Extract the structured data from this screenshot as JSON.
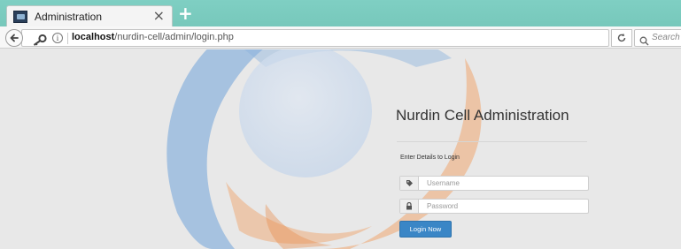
{
  "browser": {
    "tab_title": "Administration",
    "close_glyph": "×",
    "new_tab_glyph": "+",
    "url_host": "localhost",
    "url_path": "/nurdin-cell/admin/login.php",
    "info_glyph": "i",
    "search_placeholder": "Search"
  },
  "login": {
    "title": "Nurdin Cell Administration",
    "subtitle": "Enter Details to Login",
    "username_placeholder": "Username",
    "password_placeholder": "Password",
    "submit_label": "Login Now"
  },
  "icons": {
    "tab": "favicon-icon",
    "close": "close-icon",
    "new_tab": "plus-icon",
    "back": "back-arrow-icon",
    "site_identity": "key-icon",
    "info": "info-icon",
    "reload": "reload-icon",
    "search": "search-icon",
    "username_addon": "tag-icon",
    "password_addon": "lock-icon"
  },
  "colors": {
    "tabbar": "#7fcfc3",
    "primary_button": "#3a86c6",
    "watermark_blue": "#4a8fd4",
    "watermark_orange": "#f09a52"
  }
}
